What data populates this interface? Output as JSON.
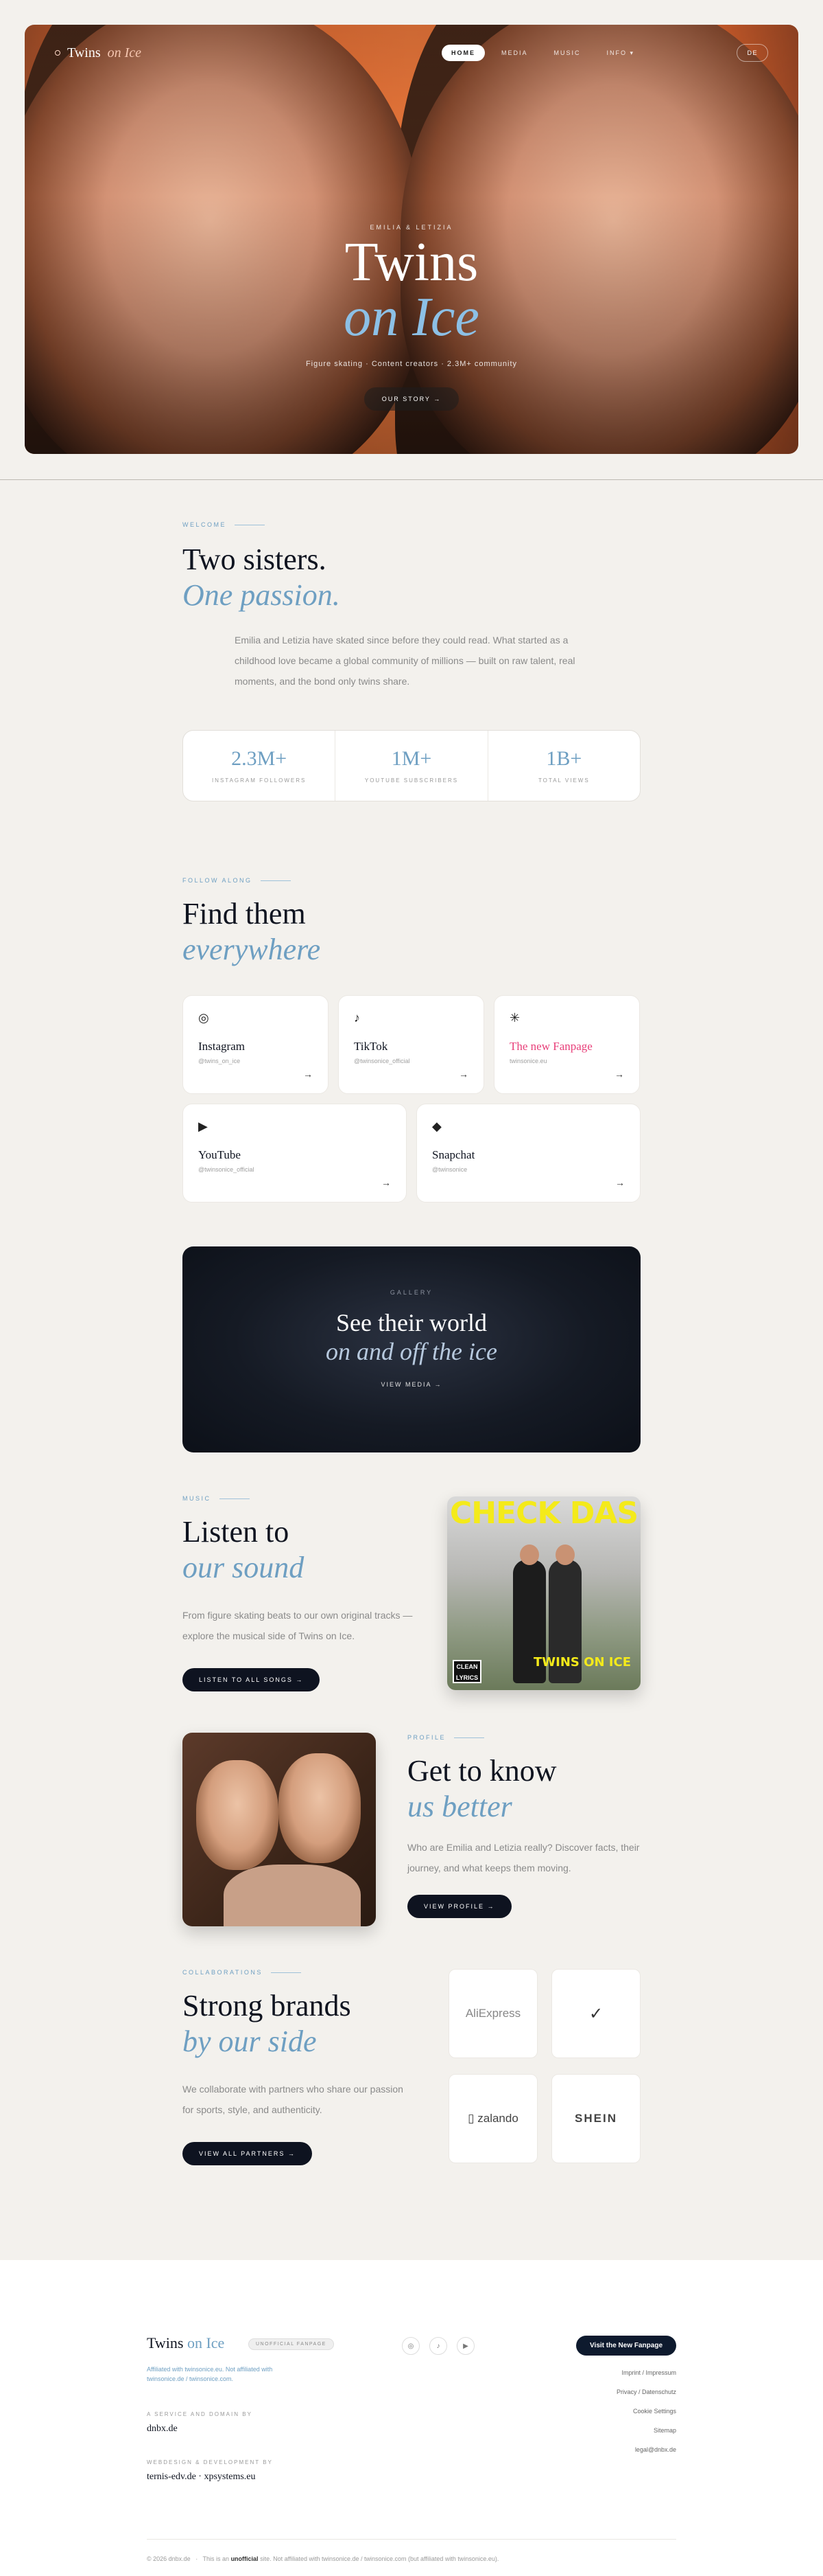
{
  "nav": {
    "logo_main": "Twins",
    "logo_accent": "on Ice",
    "items": [
      "HOME",
      "MEDIA",
      "MUSIC",
      "INFO ▾"
    ],
    "lang": "DE"
  },
  "hero": {
    "eyebrow": "EMILIA & LETIZIA",
    "title": "Twins",
    "title_accent": "on Ice",
    "subtitle": "Figure skating · Content creators · 2.3M+ community",
    "button": "OUR STORY →"
  },
  "welcome": {
    "eyebrow": "WELCOME",
    "title": "Two sisters.",
    "title_accent": "One passion.",
    "text": "Emilia and Letizia have skated since before they could read. What started as a childhood love became a global community of millions — built on raw talent, real moments, and the bond only twins share.",
    "stats": [
      {
        "value": "2.3M+",
        "label": "INSTAGRAM FOLLOWERS"
      },
      {
        "value": "1M+",
        "label": "YOUTUBE SUBSCRIBERS"
      },
      {
        "value": "1B+",
        "label": "TOTAL VIEWS"
      }
    ]
  },
  "follow": {
    "eyebrow": "FOLLOW ALONG",
    "title": "Find them",
    "title_accent": "everywhere",
    "cards": [
      {
        "icon": "◎",
        "name": "Instagram",
        "handle": "@twins_on_ice"
      },
      {
        "icon": "♪",
        "name": "TikTok",
        "handle": "@twinsonice_official"
      },
      {
        "icon": "✳",
        "name": "The new Fanpage",
        "handle": "twinsonice.eu"
      },
      {
        "icon": "▶",
        "name": "YouTube",
        "handle": "@twinsonice_official"
      },
      {
        "icon": "◆",
        "name": "Snapchat",
        "handle": "@twinsonice"
      }
    ],
    "arrow": "→"
  },
  "gallery": {
    "eyebrow": "GALLERY",
    "title": "See their world",
    "title_accent": "on and off the ice",
    "link": "VIEW MEDIA →"
  },
  "music": {
    "eyebrow": "MUSIC",
    "title": "Listen to",
    "title_accent": "our sound",
    "text": "From figure skating beats to our own original tracks — explore the musical side of Twins on Ice.",
    "button": "LISTEN TO ALL SONGS →",
    "album_title": "CHECK DAS",
    "album_logo": "TWINS ON ICE",
    "album_badge": "CLEAN LYRICS"
  },
  "profile": {
    "eyebrow": "PROFILE",
    "title": "Get to know",
    "title_accent": "us better",
    "text": "Who are Emilia and Letizia really? Discover facts, their journey, and what keeps them moving.",
    "button": "VIEW PROFILE →"
  },
  "brands": {
    "eyebrow": "COLLABORATIONS",
    "title": "Strong brands",
    "title_accent": "by our side",
    "text": "We collaborate with partners who share our passion for sports, style, and authenticity.",
    "button": "VIEW ALL PARTNERS →",
    "logos": [
      "AliExpress",
      "✓",
      "▯ zalando",
      "SHEIN"
    ]
  },
  "footer": {
    "logo_main": "Twins",
    "logo_accent": "on Ice",
    "badge": "UNOFFICIAL FANPAGE",
    "affiliation": "Affiliated with twinsonice.eu. Not affiliated with twinsonice.de / twinsonice.com.",
    "service_label": "A SERVICE AND DOMAIN BY",
    "service_value": "dnbx.de",
    "dev_label": "WEBDESIGN & DEVELOPMENT BY",
    "dev_value": "ternis-edv.de  ·  xpsystems.eu",
    "social_icons": [
      "◎",
      "♪",
      "▶"
    ],
    "fanpage_button": "Visit the New Fanpage",
    "links": [
      "Imprint / Impressum",
      "Privacy / Datenschutz",
      "Cookie Settings",
      "Sitemap",
      "legal@dnbx.de"
    ],
    "copyright": "© 2026 dnbx.de",
    "disclaimer_prefix": "This is an",
    "disclaimer_bold": "unofficial",
    "disclaimer_suffix": "site. Not affiliated with twinsonice.de / twinsonice.com (but affiliated with twinsonice.eu)."
  },
  "colors": {
    "accent": "#6e9fc2",
    "dark": "#0e1320",
    "hero_orange": "#f07a3c",
    "background": "#f3f1ed"
  }
}
